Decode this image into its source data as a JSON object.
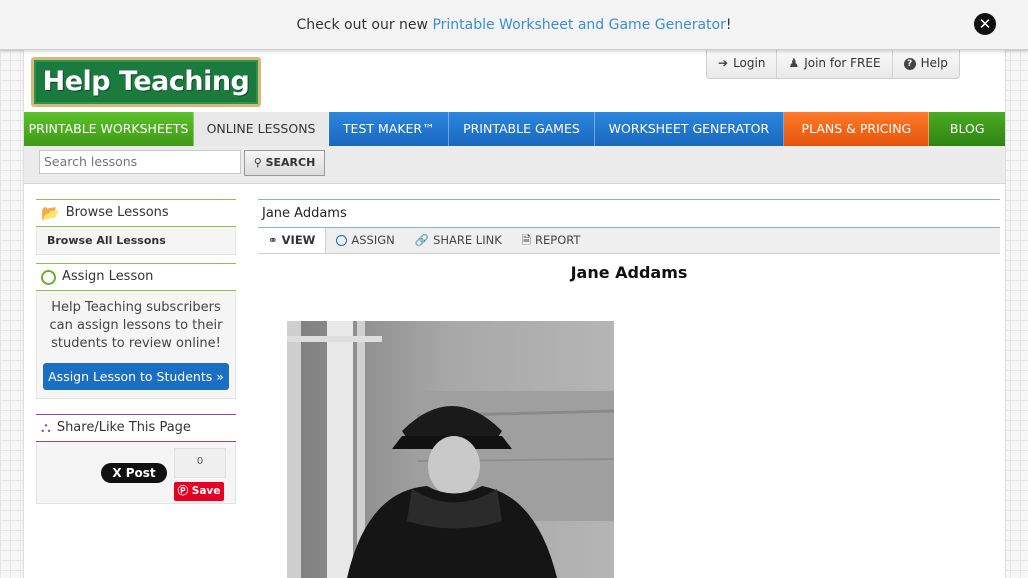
{
  "announcement": {
    "prefix": "Check out our new ",
    "link": "Printable Worksheet and Game Generator",
    "suffix": "!"
  },
  "logo": {
    "text": "Help Teaching"
  },
  "top_buttons": {
    "login": "Login",
    "join": "Join for FREE",
    "help": "Help"
  },
  "nav": {
    "items": [
      {
        "label": "PRINTABLE WORKSHEETS",
        "color": "#4caf1f"
      },
      {
        "label": "ONLINE LESSONS",
        "color": "#e8e8e8"
      },
      {
        "label": "TEST MAKER™",
        "color": "#1f78d1"
      },
      {
        "label": "PRINTABLE GAMES",
        "color": "#1f78d1"
      },
      {
        "label": "WORKSHEET GENERATOR",
        "color": "#1f78d1"
      },
      {
        "label": "PLANS & PRICING",
        "color": "#f26522"
      },
      {
        "label": "BLOG",
        "color": "#3d9b1f"
      }
    ]
  },
  "search": {
    "placeholder": "Search lessons",
    "button": "SEARCH"
  },
  "sidebar": {
    "browse_title": "Browse Lessons",
    "browse_all": "Browse All Lessons",
    "assign_title": "Assign Lesson",
    "assign_text": "Help Teaching subscribers can assign lessons to their students to review online!",
    "assign_button": "Assign Lesson to Students »",
    "share_title": "Share/Like This Page",
    "tweet_button": "X Post",
    "share_count": "0",
    "pin_button": "Save"
  },
  "lesson": {
    "breadcrumb_title": "Jane Addams",
    "tabs": {
      "view": "VIEW",
      "assign": "ASSIGN",
      "share": "SHARE LINK",
      "report": "REPORT"
    },
    "heading": "Jane Addams"
  }
}
